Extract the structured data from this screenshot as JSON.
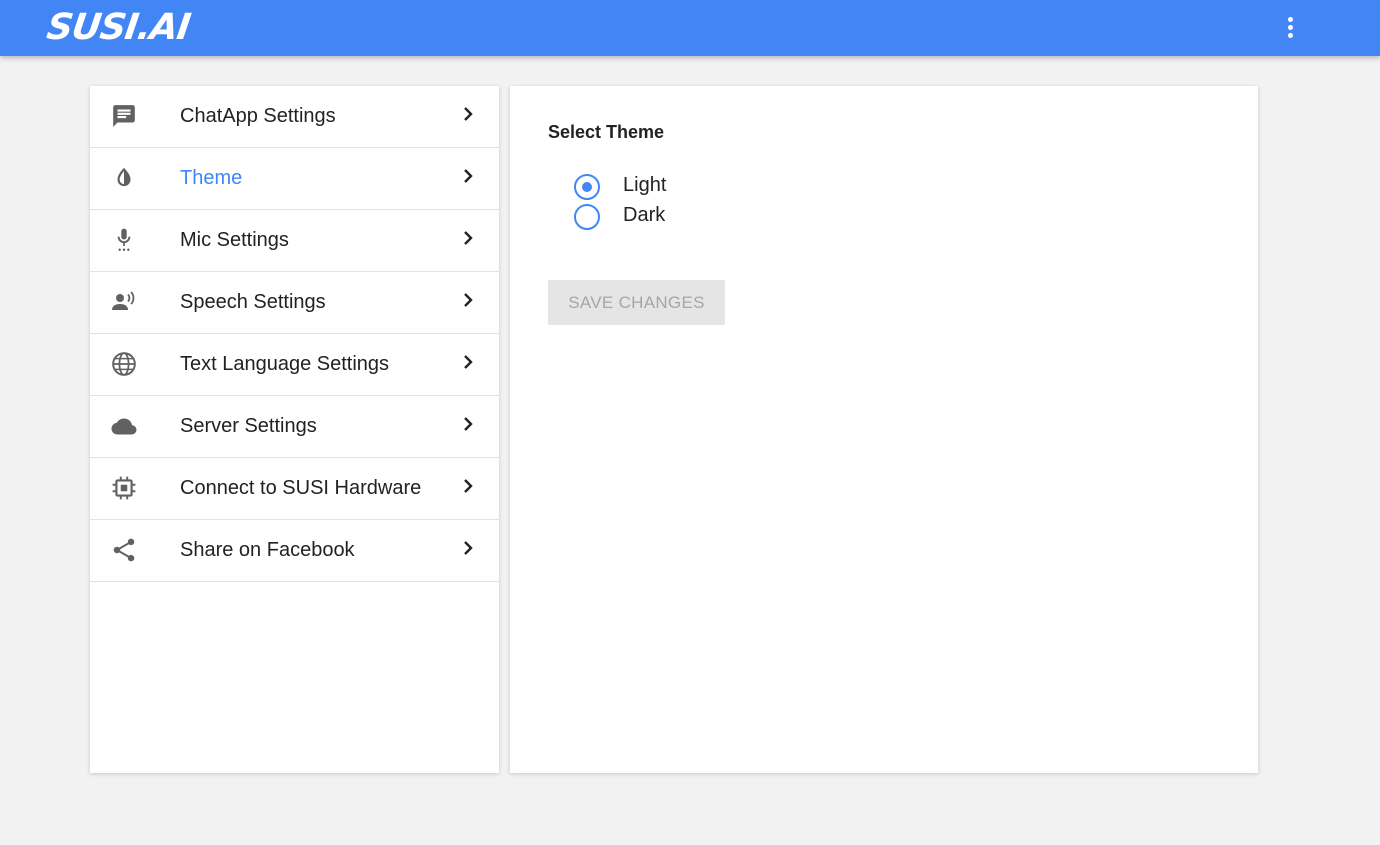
{
  "app": {
    "logo": "SUSI.AI"
  },
  "colors": {
    "primary": "#4285f4",
    "icon": "#616161"
  },
  "sidebar": {
    "items": [
      {
        "label": "ChatApp Settings",
        "icon": "chat-icon",
        "active": false
      },
      {
        "label": "Theme",
        "icon": "drop-icon",
        "active": true
      },
      {
        "label": "Mic Settings",
        "icon": "mic-icon",
        "active": false
      },
      {
        "label": "Speech Settings",
        "icon": "speaker-person-icon",
        "active": false
      },
      {
        "label": "Text Language Settings",
        "icon": "globe-icon",
        "active": false
      },
      {
        "label": "Server Settings",
        "icon": "cloud-icon",
        "active": false
      },
      {
        "label": "Connect to SUSI Hardware",
        "icon": "chip-icon",
        "active": false
      },
      {
        "label": "Share on Facebook",
        "icon": "share-icon",
        "active": false
      }
    ]
  },
  "theme_panel": {
    "title": "Select Theme",
    "options": [
      {
        "label": "Light",
        "selected": true
      },
      {
        "label": "Dark",
        "selected": false
      }
    ],
    "save_label": "SAVE CHANGES",
    "save_disabled": true
  }
}
